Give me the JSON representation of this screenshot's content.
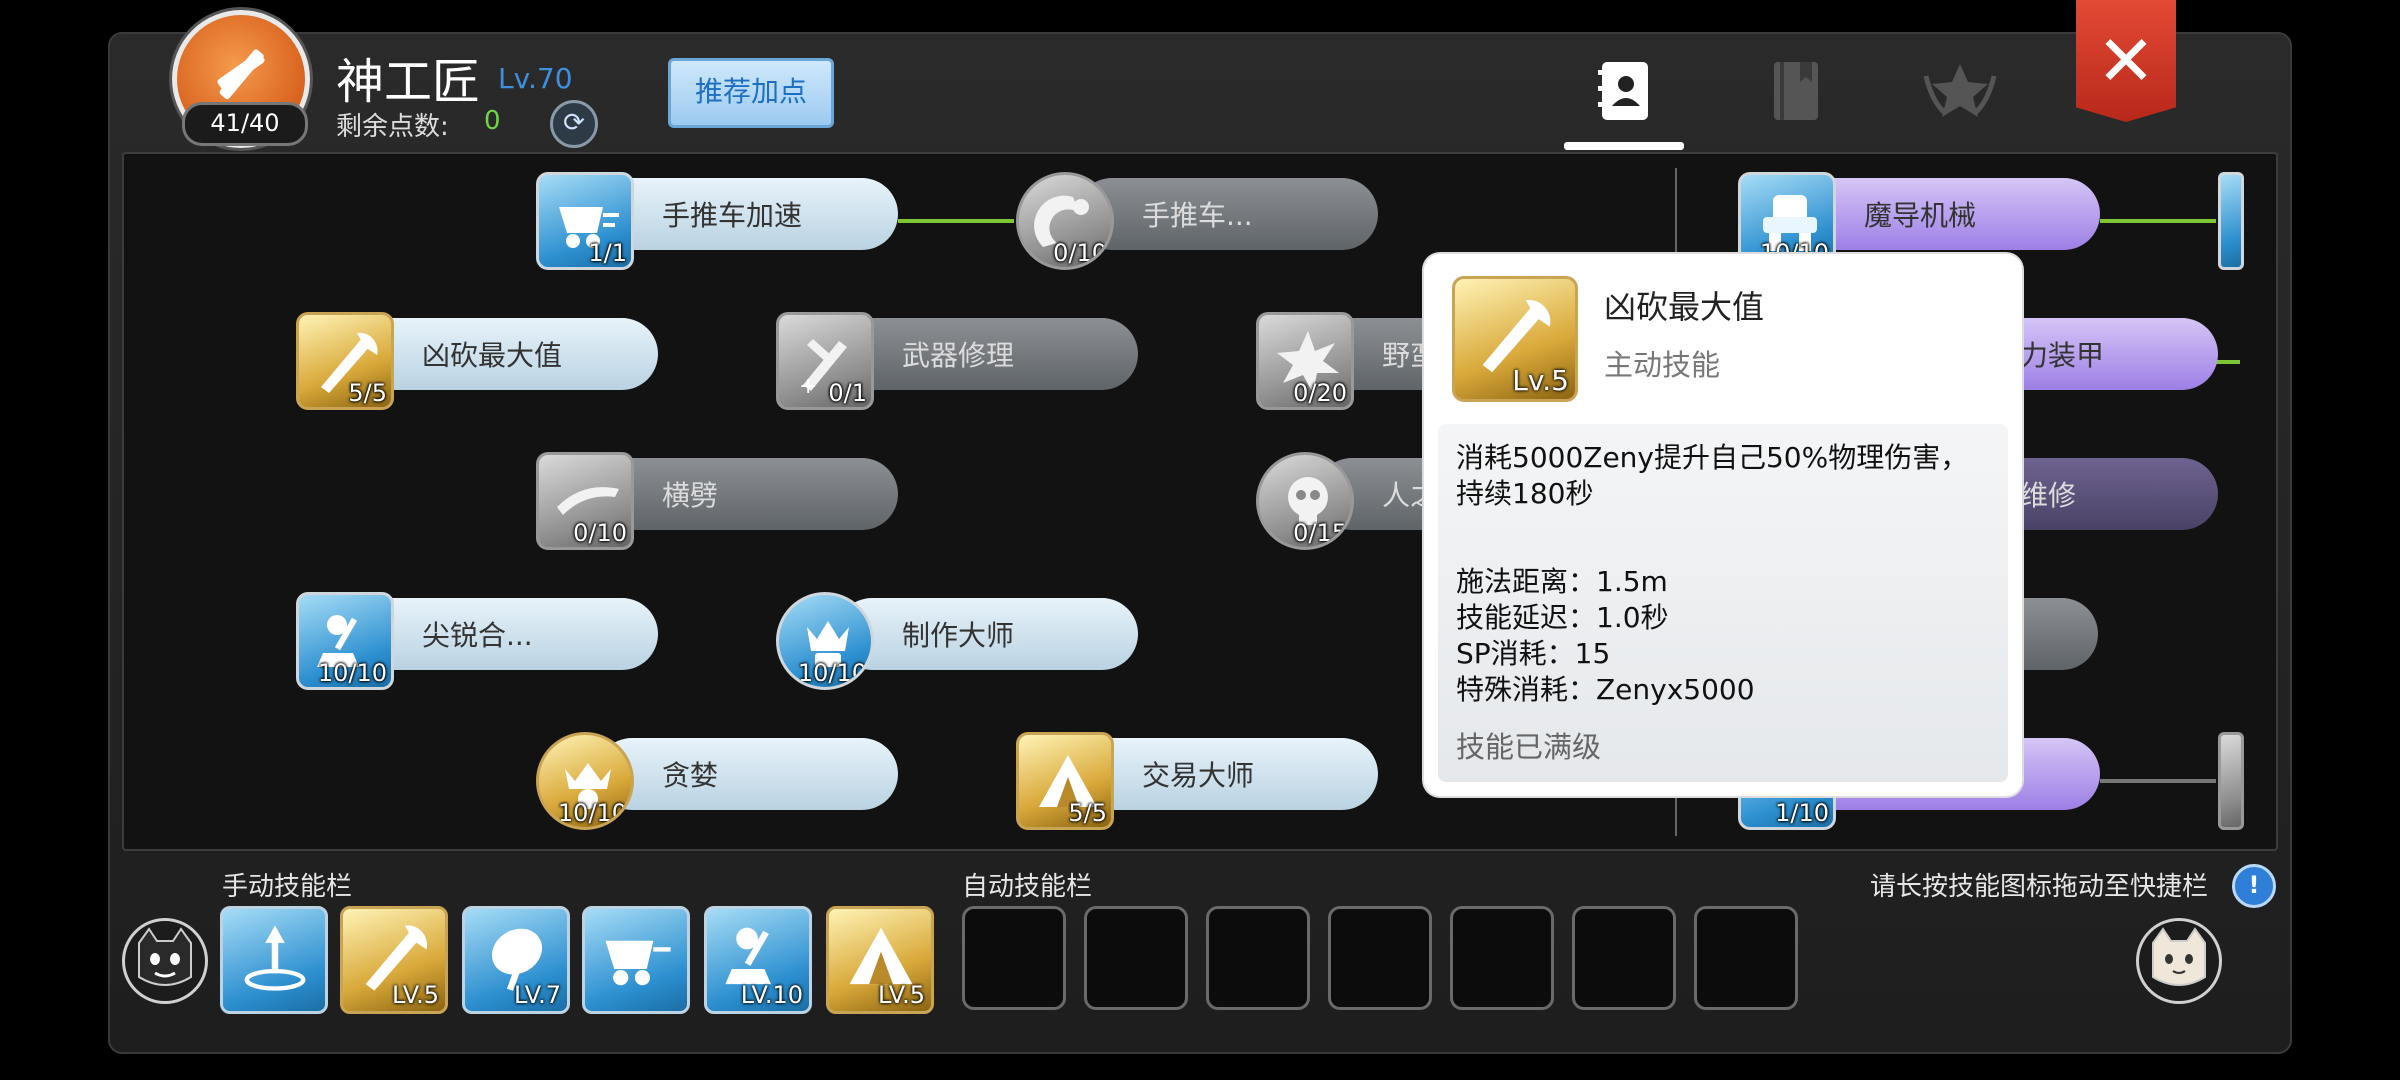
{
  "header": {
    "class_name": "神工匠",
    "class_level": "Lv.70",
    "points_used": "41/40",
    "remaining_label": "剩余点数:",
    "remaining_value": "0",
    "recommend_button": "推荐加点",
    "close_label": "✕"
  },
  "tabs": [
    {
      "name": "skill-profile",
      "active": true
    },
    {
      "name": "skill-book",
      "active": false
    },
    {
      "name": "rank-emblem",
      "active": false
    }
  ],
  "skills": [
    {
      "name": "手推车加速",
      "level": "1/1",
      "style": "blue"
    },
    {
      "name": "手推车...",
      "level": "0/10",
      "style": "gray"
    },
    {
      "name": "魔导机械",
      "level": "10/10",
      "style": "blue"
    },
    {
      "name": "凶砍最大值",
      "level": "5/5",
      "style": "gold"
    },
    {
      "name": "武器修理",
      "level": "0/1",
      "style": "gray"
    },
    {
      "name": "野蛮",
      "level": "0/20",
      "style": "gray"
    },
    {
      "name": "力装甲",
      "level": "",
      "style": "purple"
    },
    {
      "name": "横劈",
      "level": "0/10",
      "style": "gray"
    },
    {
      "name": "人之",
      "level": "0/15",
      "style": "gray"
    },
    {
      "name": "维修",
      "level": "",
      "style": "purple-gray"
    },
    {
      "name": "尖锐合...",
      "level": "10/10",
      "style": "blue"
    },
    {
      "name": "制作大师",
      "level": "10/10",
      "style": "blue"
    },
    {
      "name": "贪婪",
      "level": "10/10",
      "style": "gold"
    },
    {
      "name": "交易大师",
      "level": "5/5",
      "style": "gold"
    },
    {
      "name": "",
      "level": "1/10",
      "style": "blue"
    }
  ],
  "tooltip": {
    "title": "凶砍最大值",
    "type": "主动技能",
    "level": "Lv.5",
    "description": "消耗5000Zeny提升自己50%物理伤害，持续180秒",
    "stats": [
      "施法距离：1.5m",
      "技能延迟：1.0秒",
      "SP消耗：15",
      "特殊消耗：Zenyx5000"
    ],
    "max_note": "技能已满级"
  },
  "manual_bar": {
    "label": "手动技能栏",
    "slots": [
      {
        "level": "",
        "style": "blue"
      },
      {
        "level": "LV.5",
        "style": "gold"
      },
      {
        "level": "LV.7",
        "style": "blue"
      },
      {
        "level": "",
        "style": "blue"
      },
      {
        "level": "LV.10",
        "style": "blue"
      },
      {
        "level": "LV.5",
        "style": "gold"
      }
    ]
  },
  "auto_bar": {
    "label": "自动技能栏",
    "slot_count": 7
  },
  "hint": "请长按技能图标拖动至快捷栏",
  "info_icon": "!"
}
